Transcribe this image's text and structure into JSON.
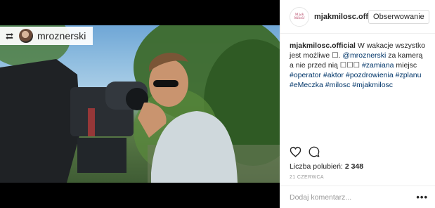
{
  "repost": {
    "username": "mroznerski"
  },
  "post": {
    "username": "mjakmilosc.off",
    "avatar_text": "M jak Miłość",
    "follow_label": "Obserwowanie",
    "caption": {
      "author": "mjakmilosc.official",
      "text_1": "W wakacje wszystko jest możliwe ☐.",
      "mention": "@mroznerski",
      "text_2": "za kamerą a nie przed nią ☐☐☐",
      "tag_zamiana": "#zamiana",
      "text_3": "miejsc",
      "tags": [
        "#operator",
        "#aktor",
        "#pozdrowienia",
        "#zplanu",
        "#eMeczka",
        "#milosc",
        "#mjakmilosc"
      ]
    },
    "likes_label": "Liczba polubień:",
    "likes_count": "2 348",
    "date": "21 CZERWCA",
    "comment_placeholder": "Dodaj komentarz...",
    "more_label": "•••"
  },
  "icons": [
    "repost-icon",
    "heart-icon",
    "comment-icon"
  ],
  "colors": {
    "hashtag": "#003569",
    "text": "#262626",
    "muted": "#999999",
    "border": "#efefef"
  }
}
